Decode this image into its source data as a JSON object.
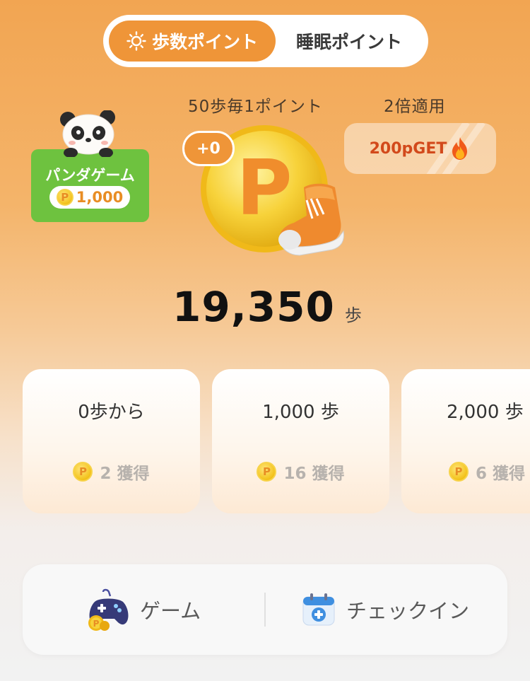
{
  "tabs": {
    "active_label": "歩数ポイント",
    "inactive_label": "睡眠ポイント"
  },
  "rate": {
    "label": "50歩毎1ポイント",
    "plus": "+0"
  },
  "bonus": {
    "label": "2倍適用",
    "badge_text": "200pGET"
  },
  "panda_game": {
    "title": "パンダゲーム",
    "coins": "1,000"
  },
  "coin_letter": "P",
  "steps": {
    "count": "19,350",
    "unit": "歩"
  },
  "milestones": [
    {
      "title": "0歩から",
      "reward": "2 獲得"
    },
    {
      "title": "1,000 歩",
      "reward": "16 獲得"
    },
    {
      "title": "2,000 歩",
      "reward": "6 獲得"
    }
  ],
  "bottom": {
    "game_label": "ゲーム",
    "checkin_label": "チェックイン"
  },
  "colors": {
    "accent": "#ef9538",
    "panda_card": "#6ec23f",
    "bonus_text": "#d2491b",
    "coin": "#f3c21b"
  }
}
